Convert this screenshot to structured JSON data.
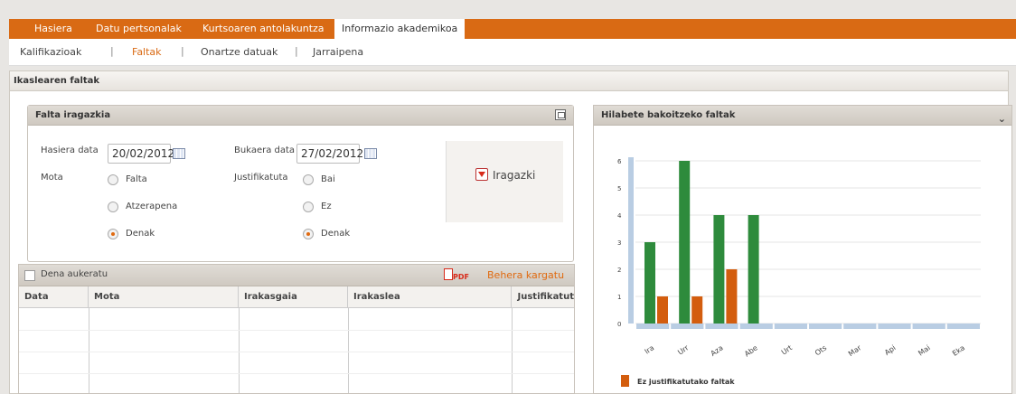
{
  "nav": {
    "tabs": [
      {
        "label": "Hasiera"
      },
      {
        "label": "Datu pertsonalak"
      },
      {
        "label": "Kurtsoaren antolakuntza"
      },
      {
        "label": "Informazio akademikoa"
      }
    ]
  },
  "subnav": {
    "items": [
      {
        "label": "Kalifikazioak"
      },
      {
        "label": "Faltak"
      },
      {
        "label": "Onartze datuak"
      },
      {
        "label": "Jarraipena"
      }
    ],
    "separator": "|"
  },
  "page": {
    "title": "Ikaslearen faltak"
  },
  "filter": {
    "title": "Falta iragazkia",
    "start_label": "Hasiera data",
    "start_value": "20/02/2012",
    "end_label": "Bukaera data",
    "end_value": "27/02/2012",
    "type_label": "Mota",
    "type_options": [
      "Falta",
      "Atzerapena",
      "Denak"
    ],
    "type_selected": "Denak",
    "just_label": "Justifikatuta",
    "just_options": [
      "Bai",
      "Ez",
      "Denak"
    ],
    "just_selected": "Denak",
    "button_label": "Iragazki"
  },
  "table": {
    "select_all": "Dena aukeratu",
    "pdf_label": "PDF",
    "download_label": "Behera kargatu",
    "columns": [
      "Data",
      "Mota",
      "Irakasgaia",
      "Irakaslea",
      "Justifikatut"
    ]
  },
  "chart_panel": {
    "title": "Hilabete bakoitzeko faltak"
  },
  "colors": {
    "accent": "#d96a14",
    "green": "#2e8b3c",
    "orange": "#d35d0e",
    "track": "#b9cde3"
  },
  "chart_data": {
    "type": "bar",
    "categories": [
      "Ira",
      "Urr",
      "Aza",
      "Abe",
      "Urt",
      "Ots",
      "Mar",
      "Api",
      "Mai",
      "Eka"
    ],
    "series": [
      {
        "values": [
          3,
          6,
          4,
          4,
          0,
          0,
          0,
          0,
          0,
          0
        ]
      },
      {
        "name": "Ez justifikatutako faltak",
        "values": [
          1,
          1,
          2,
          0,
          0,
          0,
          0,
          0,
          0,
          0
        ]
      }
    ],
    "yticks": [
      "0",
      "1",
      "2",
      "3",
      "4",
      "5",
      "6"
    ],
    "ylim": [
      0,
      6
    ],
    "grid": true,
    "legend": "bottom-left"
  }
}
